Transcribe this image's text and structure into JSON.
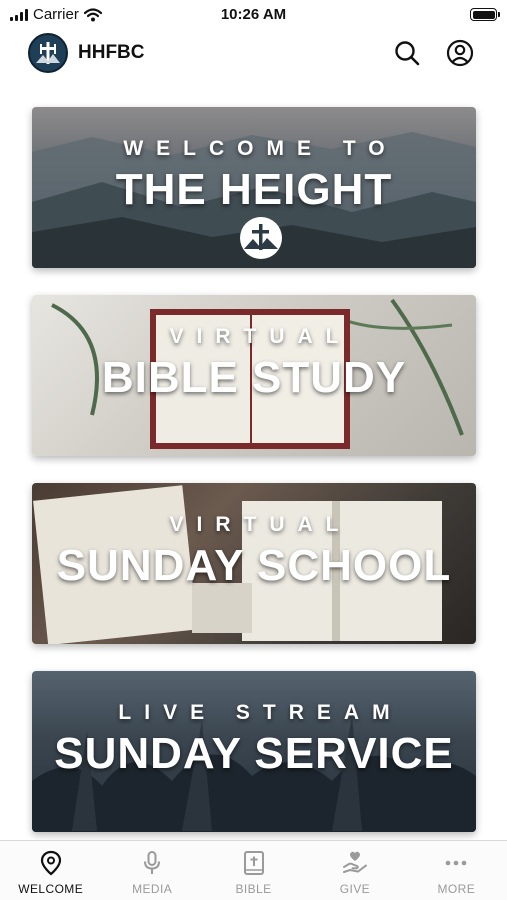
{
  "status_bar": {
    "carrier": "Carrier",
    "time": "10:26 AM"
  },
  "header": {
    "title": "HHFBC"
  },
  "cards": [
    {
      "line1": "WELCOME TO",
      "line2": "THE HEIGHT"
    },
    {
      "line1": "VIRTUAL",
      "line2": "BIBLE STUDY"
    },
    {
      "line1": "VIRTUAL",
      "line2": "SUNDAY SCHOOL"
    },
    {
      "line1": "LIVE STREAM",
      "line2": "SUNDAY SERVICE"
    }
  ],
  "tabs": [
    {
      "label": "WELCOME",
      "icon": "location-pin-icon",
      "active": true
    },
    {
      "label": "MEDIA",
      "icon": "microphone-icon",
      "active": false
    },
    {
      "label": "BIBLE",
      "icon": "bible-icon",
      "active": false
    },
    {
      "label": "GIVE",
      "icon": "give-hand-icon",
      "active": false
    },
    {
      "label": "MORE",
      "icon": "more-dots-icon",
      "active": false
    }
  ]
}
